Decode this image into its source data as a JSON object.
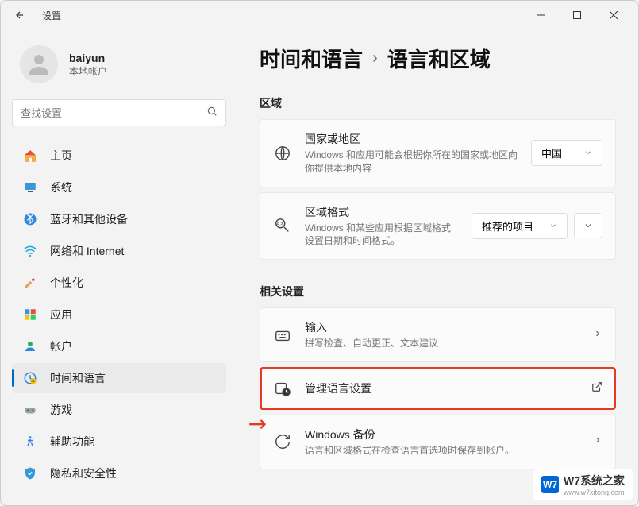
{
  "titlebar": {
    "title": "设置"
  },
  "user": {
    "name": "baiyun",
    "type": "本地帐户"
  },
  "search": {
    "placeholder": "查找设置"
  },
  "nav": {
    "items": [
      {
        "label": "主页"
      },
      {
        "label": "系统"
      },
      {
        "label": "蓝牙和其他设备"
      },
      {
        "label": "网络和 Internet"
      },
      {
        "label": "个性化"
      },
      {
        "label": "应用"
      },
      {
        "label": "帐户"
      },
      {
        "label": "时间和语言"
      },
      {
        "label": "游戏"
      },
      {
        "label": "辅助功能"
      },
      {
        "label": "隐私和安全性"
      }
    ]
  },
  "breadcrumb": {
    "parent": "时间和语言",
    "sep": "›",
    "current": "语言和区域"
  },
  "sections": {
    "region": {
      "title": "区域",
      "country": {
        "title": "国家或地区",
        "desc": "Windows 和应用可能会根据你所在的国家或地区向你提供本地内容",
        "value": "中国"
      },
      "format": {
        "title": "区域格式",
        "desc": "Windows 和某些应用根据区域格式设置日期和时间格式。",
        "value": "推荐的项目"
      }
    },
    "related": {
      "title": "相关设置",
      "input": {
        "title": "输入",
        "desc": "拼写检查、自动更正、文本建议"
      },
      "admin": {
        "title": "管理语言设置"
      },
      "backup": {
        "title": "Windows 备份",
        "desc": "语言和区域格式在检查语言首选项时保存到帐户。"
      }
    }
  },
  "watermark": {
    "iconText": "W7",
    "text": "W7系统之家",
    "url": "www.w7xitong.com"
  }
}
